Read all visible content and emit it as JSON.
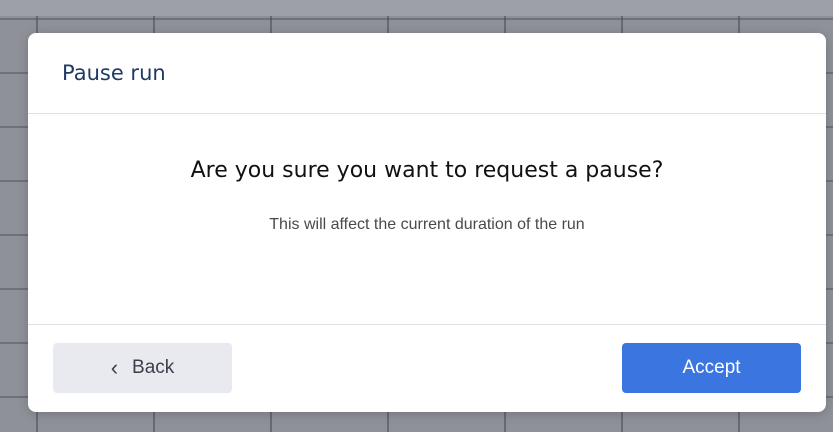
{
  "dialog": {
    "title": "Pause run",
    "question": "Are you sure you want to request a pause?",
    "subtext": "This will affect the current duration of the run",
    "back_label": "Back",
    "back_icon": "chevron-left-icon",
    "accept_label": "Accept"
  },
  "colors": {
    "title": "#1f3a64",
    "accent": "#3b76e0",
    "back_button_bg": "#e8eaf0",
    "backdrop": "#8e9198"
  }
}
